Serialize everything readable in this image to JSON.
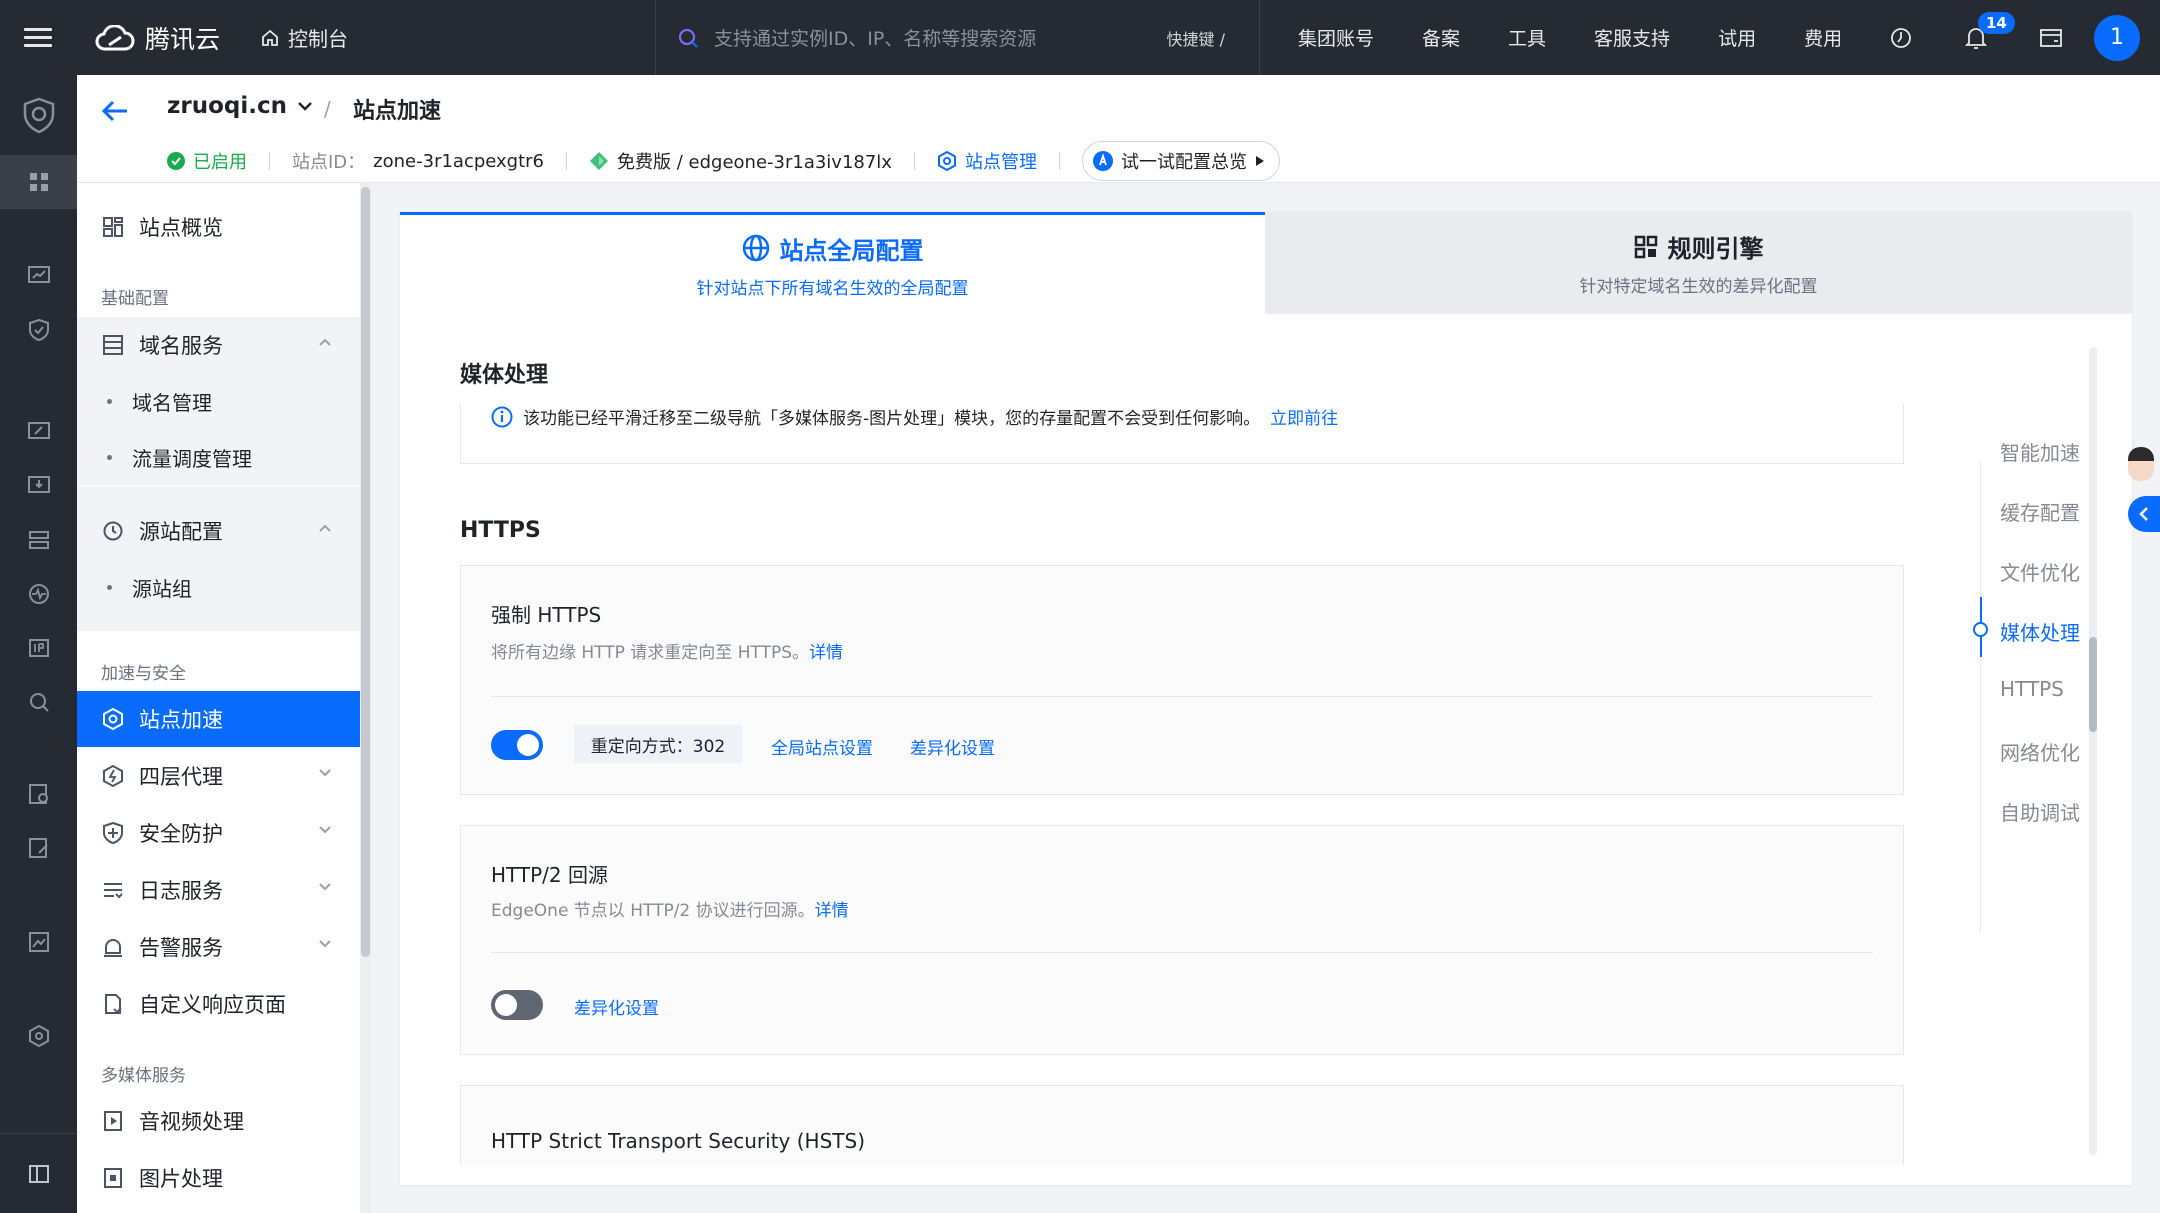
{
  "topbar": {
    "brand": "腾讯云",
    "console": "控制台",
    "search_placeholder": "支持通过实例ID、IP、名称等搜索资源",
    "shortcut": "快捷键 /",
    "nav": [
      "集团账号",
      "备案",
      "工具",
      "客服支持",
      "试用",
      "费用"
    ],
    "notification_count": "14",
    "avatar_text": "1"
  },
  "header": {
    "site_name": "zruoqi.cn",
    "breadcrumb_sep": "/",
    "current_page": "站点加速",
    "status": "已启用",
    "site_id_label": "站点ID：",
    "site_id": "zone-3r1acpexgtr6",
    "plan": "免费版 / edgeone-3r1a3iv187lx",
    "site_manage": "站点管理",
    "try_config": "试一试配置总览"
  },
  "sidebar": {
    "overview": "站点概览",
    "group_basic": "基础配置",
    "domain_service": "域名服务",
    "domain_manage": "域名管理",
    "traffic_schedule": "流量调度管理",
    "origin_config": "源站配置",
    "origin_group": "源站组",
    "group_accel": "加速与安全",
    "site_accel": "站点加速",
    "l4_proxy": "四层代理",
    "security": "安全防护",
    "log_service": "日志服务",
    "alarm_service": "告警服务",
    "custom_page": "自定义响应页面",
    "group_media": "多媒体服务",
    "av_process": "音视频处理",
    "image_process": "图片处理"
  },
  "tabs": {
    "global_title": "站点全局配置",
    "global_sub": "针对站点下所有域名生效的全局配置",
    "rules_title": "规则引擎",
    "rules_sub": "针对特定域名生效的差异化配置"
  },
  "content": {
    "media_title": "媒体处理",
    "media_notice": "该功能已经平滑迁移至二级导航「多媒体服务-图片处理」模块，您的存量配置不会受到任何影响。",
    "media_link": "立即前往",
    "https_title": "HTTPS",
    "force_https_title": "强制 HTTPS",
    "force_https_desc": "将所有边缘 HTTP 请求重定向至 HTTPS。",
    "details": "详情",
    "redirect_mode": "重定向方式：302",
    "global_setting": "全局站点设置",
    "diff_setting": "差异化设置",
    "http2_title": "HTTP/2 回源",
    "http2_desc": "EdgeOne 节点以 HTTP/2 协议进行回源。",
    "hsts_title": "HTTP Strict Transport Security (HSTS)",
    "force_https_enabled": true,
    "http2_enabled": false
  },
  "anchor_nav": [
    "智能加速",
    "缓存配置",
    "文件优化",
    "媒体处理",
    "HTTPS",
    "网络优化",
    "自助调试"
  ],
  "colors": {
    "primary": "#0a6cff",
    "topbar_bg": "#262a33",
    "success": "#1aab4f"
  }
}
